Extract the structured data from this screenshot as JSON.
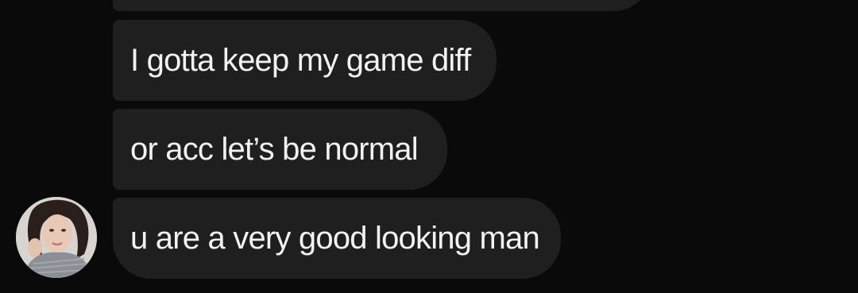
{
  "messages": [
    {
      "text": ""
    },
    {
      "text": "I gotta keep my game diff"
    },
    {
      "text": "or acc let’s be normal"
    },
    {
      "text": "u are a very good looking man"
    }
  ],
  "colors": {
    "background": "#0a0a0a",
    "bubble": "#1f1f1f",
    "text": "#f2f2f2"
  }
}
